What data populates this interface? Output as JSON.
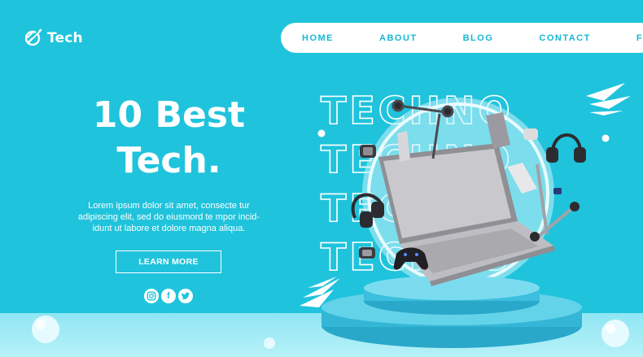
{
  "brand": {
    "name": "Tech",
    "logo_icon": "rocket-icon"
  },
  "nav": {
    "items": [
      {
        "label": "HOME"
      },
      {
        "label": "ABOUT"
      },
      {
        "label": "BLOG"
      },
      {
        "label": "CONTACT"
      },
      {
        "label": "FAQ"
      }
    ]
  },
  "hero": {
    "title_line1": "10 Best",
    "title_line2": "Tech.",
    "body_line1": "Lorem ipsum dolor sit amet, consecte tur",
    "body_line2": "adipiscing elit, sed do eiusmord te mpor incid-",
    "body_line3": "idunt ut labore et dolore magna aliqua.",
    "cta_label": "LEARN MORE"
  },
  "social": [
    {
      "icon": "instagram-icon"
    },
    {
      "icon": "facebook-icon",
      "glyph": "f"
    },
    {
      "icon": "twitter-icon"
    }
  ],
  "illustration": {
    "background_word": "TECHNO"
  },
  "colors": {
    "background": "#1fc3dc",
    "accent": "#17b7d3",
    "white": "#ffffff"
  }
}
